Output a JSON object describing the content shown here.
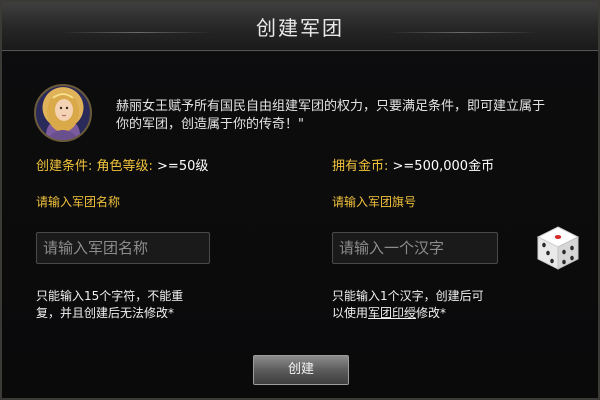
{
  "dialog": {
    "title": "创建军团"
  },
  "npc": {
    "quote_line1": "赫丽女王赋予所有国民自由组建军团的权力，只要满足条件，即可建立属于",
    "quote_line2": "你的军团，创造属于你的传奇！\""
  },
  "requirements": {
    "level_label": "创建条件: 角色等级:",
    "level_value": " >=50级",
    "gold_label": "拥有金币:",
    "gold_value": " >=500,000金币"
  },
  "name_field": {
    "label": "请输入军团名称",
    "placeholder": "请输入军团名称",
    "note_line1": "只能输入15个字符，不能重",
    "note_line2": "复，并且创建后无法修改*"
  },
  "flag_field": {
    "label": "请输入军团旗号",
    "placeholder": "请输入一个汉字",
    "note_line1": "只能输入1个汉字，创建后可",
    "note_prefix": "以使用",
    "note_link": "军团印绶",
    "note_suffix": "修改*"
  },
  "actions": {
    "create_label": "创建"
  },
  "icons": {
    "avatar": "queen-portrait-icon",
    "dice": "dice-icon"
  },
  "colors": {
    "accent_gold": "#f0c23c",
    "dice_pip": "#d42a2a"
  }
}
